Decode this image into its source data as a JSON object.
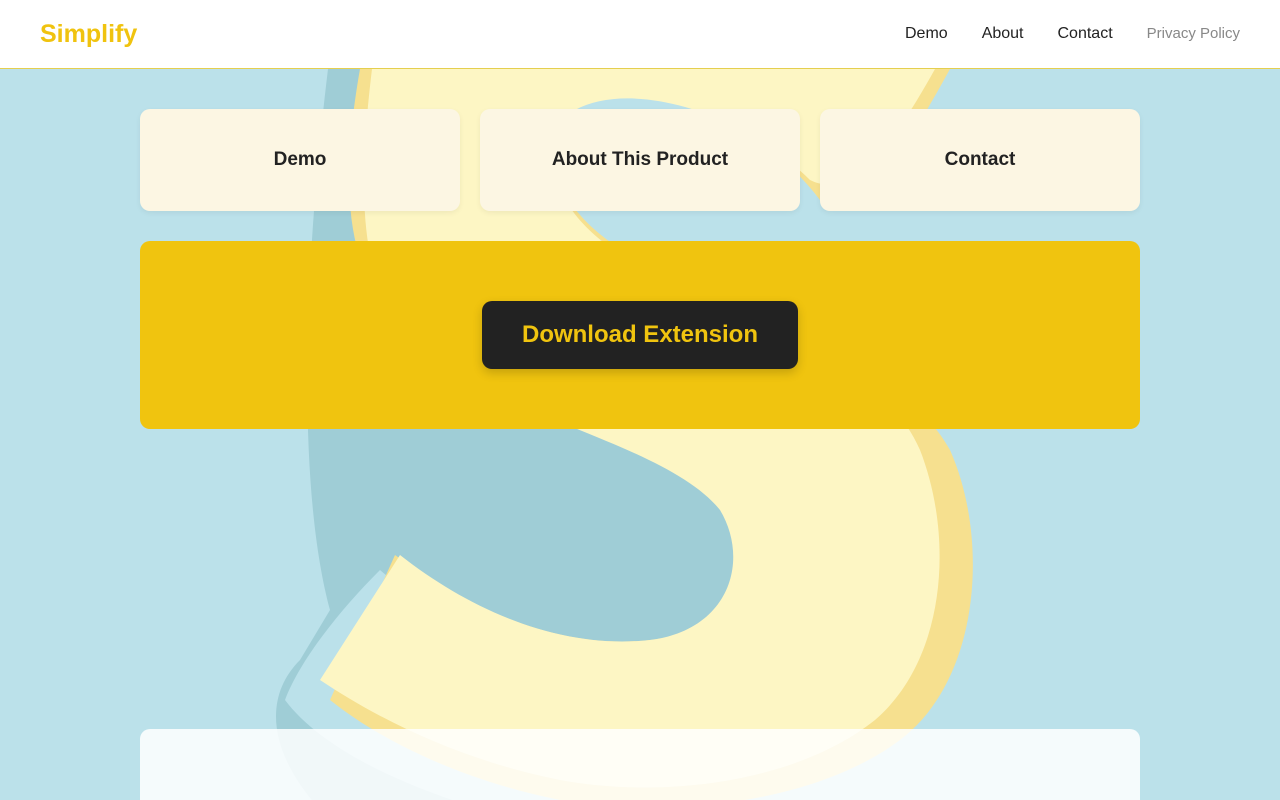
{
  "header": {
    "logo": "Simplify",
    "nav": [
      {
        "label": "Demo"
      },
      {
        "label": "About"
      },
      {
        "label": "Contact"
      },
      {
        "label": "Privacy Policy"
      }
    ]
  },
  "cards": [
    {
      "label": "Demo"
    },
    {
      "label": "About This Product"
    },
    {
      "label": "Contact"
    }
  ],
  "cta": {
    "button_label": "Download Extension"
  },
  "colors": {
    "brand_yellow": "#f0c40f",
    "background_blue": "#bbe1ea",
    "card_cream": "#fcf6e3",
    "button_dark": "#222222"
  },
  "icons": {
    "background": "letter-s-illustration"
  }
}
